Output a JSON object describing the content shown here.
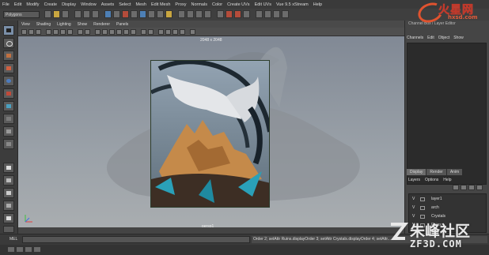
{
  "menubar": [
    "File",
    "Edit",
    "Modify",
    "Create",
    "Display",
    "Window",
    "Assets",
    "Select",
    "Mesh",
    "Edit Mesh",
    "Proxy",
    "Normals",
    "Color",
    "Create UVs",
    "Edit UVs",
    "Vue 9.5 xStream",
    "Help"
  ],
  "status": {
    "mode": "Polygons"
  },
  "viewport": {
    "menus": [
      "View",
      "Shading",
      "Lighting",
      "Show",
      "Renderer",
      "Panels"
    ],
    "resolution": "2048 x 2048",
    "camera": "persp1"
  },
  "right_panel": {
    "title": "Channel Box / Layer Editor",
    "tabs": [
      "Channels",
      "Edit",
      "Object",
      "Show"
    ],
    "layer_tabs": [
      "Display",
      "Render",
      "Anim"
    ],
    "layer_menu": [
      "Layers",
      "Options",
      "Help"
    ],
    "layers": [
      {
        "visible": "V",
        "name": "layer1"
      },
      {
        "visible": "V",
        "name": "arch"
      },
      {
        "visible": "V",
        "name": "Crystals"
      },
      {
        "visible": "V",
        "name": "Ruins"
      }
    ]
  },
  "command": {
    "label": "MEL",
    "result": "Order 2; setAttr Ruins.displayOrder 3; setAttr Crystals.displayOrder 4; setAttr..."
  },
  "watermarks": {
    "top_right_cn": "火星网",
    "top_right_url": "hxsd.com",
    "bottom_right_cn": "朱峰社区",
    "bottom_right_url": "ZF3D.COM"
  },
  "colors": {
    "accent": "#e0532f",
    "viewport_bg": "#8a929b",
    "panel_bg": "#444444"
  }
}
